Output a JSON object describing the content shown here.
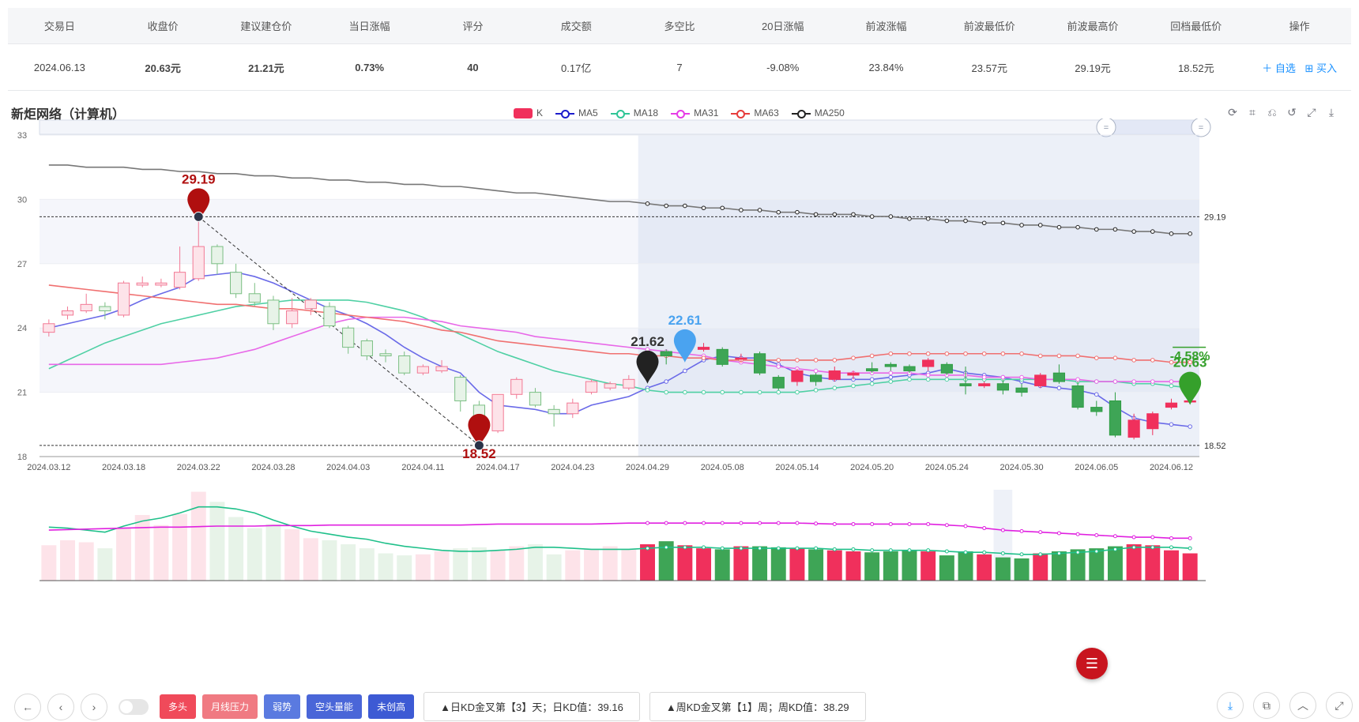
{
  "table": {
    "headers": [
      "交易日",
      "收盘价",
      "建议建仓价",
      "当日涨幅",
      "评分",
      "成交额",
      "多空比",
      "20日涨幅",
      "前波涨幅",
      "前波最低价",
      "前波最高价",
      "回档最低价",
      "操作"
    ],
    "row": {
      "date": "2024.06.13",
      "close": "20.63元",
      "suggest": "21.21元",
      "day_change": "0.73%",
      "score": "40",
      "amount": "0.17亿",
      "ratio": "7",
      "change20": "-9.08%",
      "wave_change": "23.84%",
      "wave_low": "23.57元",
      "wave_high": "29.19元",
      "pullback_low": "18.52元",
      "op_watch": "＋ 自选",
      "op_buy": "⊞ 买入"
    }
  },
  "chart_title": "新炬网络（计算机）",
  "legend": [
    {
      "label": "K",
      "color": "#f0305c",
      "icon": "rect"
    },
    {
      "label": "MA5",
      "color": "#1c1ccc",
      "icon": "line"
    },
    {
      "label": "MA18",
      "color": "#2fc596",
      "icon": "line"
    },
    {
      "label": "MA31",
      "color": "#e63ce6",
      "icon": "line"
    },
    {
      "label": "MA63",
      "color": "#e63c3c",
      "icon": "line"
    },
    {
      "label": "MA250",
      "color": "#222222",
      "icon": "line"
    }
  ],
  "toolbox": [
    "refresh-icon",
    "zoom-area-icon",
    "zoom-reset-icon",
    "restore-icon",
    "fullscreen-icon",
    "download-icon"
  ],
  "chart_data": {
    "type": "candlestick",
    "ylim": [
      18,
      33
    ],
    "yticks": [
      "33",
      "30",
      "27",
      "24",
      "21",
      "18"
    ],
    "xticks": [
      "2024.03.12",
      "2024.03.18",
      "2024.03.22",
      "2024.03.28",
      "2024.04.03",
      "2024.04.11",
      "2024.04.17",
      "2024.04.23",
      "2024.04.29",
      "2024.05.08",
      "2024.05.14",
      "2024.05.20",
      "2024.05.24",
      "2024.05.30",
      "2024.06.05",
      "2024.06.12"
    ],
    "hlines": [
      "29.19",
      "18.52"
    ],
    "markers": [
      {
        "label": "29.19",
        "value": 29.19,
        "color": "#b00f0f",
        "label_color": "#b00f0f"
      },
      {
        "label": "18.52",
        "value": 18.52,
        "color": "#b00f0f",
        "label_color": "#b00f0f"
      },
      {
        "label": "21.62",
        "value": 21.62,
        "color": "#222222",
        "label_color": "#333333"
      },
      {
        "label": "22.61",
        "value": 22.61,
        "color": "#4aa3f0",
        "label_color": "#4aa3f0"
      },
      {
        "label": "20.63",
        "value": 20.63,
        "color": "#35a02b",
        "label_color": "#35a02b"
      }
    ],
    "right_annotation": "-4.58%",
    "candles": [
      [
        23.8,
        24.2,
        24.4,
        23.6
      ],
      [
        24.6,
        24.8,
        25.0,
        24.4
      ],
      [
        24.8,
        25.1,
        25.6,
        24.7
      ],
      [
        25.0,
        24.8,
        25.2,
        24.4
      ],
      [
        24.6,
        26.1,
        26.2,
        24.5
      ],
      [
        26.0,
        26.1,
        26.4,
        25.9
      ],
      [
        26.0,
        26.1,
        26.3,
        25.9
      ],
      [
        25.9,
        26.6,
        27.8,
        25.8
      ],
      [
        26.3,
        27.8,
        29.19,
        26.2
      ],
      [
        27.8,
        27.0,
        27.9,
        26.5
      ],
      [
        26.6,
        25.6,
        27.0,
        25.4
      ],
      [
        25.6,
        25.2,
        26.1,
        25.0
      ],
      [
        25.3,
        24.2,
        25.5,
        23.9
      ],
      [
        24.2,
        24.8,
        25.4,
        24.0
      ],
      [
        24.9,
        25.3,
        25.4,
        24.6
      ],
      [
        25.0,
        24.1,
        25.2,
        24.0
      ],
      [
        24.0,
        23.1,
        24.1,
        22.8
      ],
      [
        23.4,
        22.7,
        23.5,
        22.5
      ],
      [
        22.8,
        22.7,
        23.0,
        22.4
      ],
      [
        22.7,
        21.9,
        22.9,
        21.8
      ],
      [
        21.9,
        22.2,
        22.3,
        21.8
      ],
      [
        22.0,
        22.2,
        22.5,
        21.9
      ],
      [
        21.7,
        20.6,
        21.8,
        20.1
      ],
      [
        20.4,
        19.6,
        20.6,
        18.52
      ],
      [
        19.2,
        20.9,
        20.9,
        19.1
      ],
      [
        20.9,
        21.6,
        21.7,
        20.7
      ],
      [
        21.0,
        20.4,
        21.2,
        20.3
      ],
      [
        20.2,
        20.0,
        20.4,
        19.4
      ],
      [
        20.0,
        20.5,
        20.7,
        19.8
      ],
      [
        21.0,
        21.5,
        21.6,
        20.9
      ],
      [
        21.2,
        21.4,
        21.5,
        21.1
      ],
      [
        21.2,
        21.6,
        21.8,
        21.1
      ],
      [
        22.1,
        22.7,
        22.9,
        22.0
      ],
      [
        22.9,
        22.7,
        23.0,
        22.3
      ],
      [
        22.9,
        23.1,
        23.2,
        22.8
      ],
      [
        23.0,
        23.1,
        23.3,
        22.9
      ],
      [
        23.0,
        22.3,
        23.1,
        22.2
      ],
      [
        22.6,
        22.6,
        22.8,
        22.4
      ],
      [
        22.8,
        21.9,
        22.9,
        21.8
      ],
      [
        21.7,
        21.2,
        21.8,
        21.1
      ],
      [
        21.5,
        22.0,
        22.1,
        21.3
      ],
      [
        21.8,
        21.5,
        21.9,
        21.3
      ],
      [
        21.6,
        22.0,
        22.2,
        21.5
      ],
      [
        21.8,
        21.9,
        22.0,
        21.6
      ],
      [
        22.1,
        22.0,
        22.4,
        21.9
      ],
      [
        22.3,
        22.2,
        22.4,
        22.0
      ],
      [
        22.2,
        22.0,
        22.3,
        21.9
      ],
      [
        22.2,
        22.5,
        22.6,
        22.0
      ],
      [
        22.3,
        21.9,
        22.4,
        21.8
      ],
      [
        21.4,
        21.3,
        22.2,
        20.9
      ],
      [
        21.3,
        21.4,
        21.5,
        21.2
      ],
      [
        21.4,
        21.1,
        21.6,
        20.9
      ],
      [
        21.2,
        21.0,
        21.4,
        20.8
      ],
      [
        21.3,
        21.8,
        21.9,
        21.2
      ],
      [
        21.9,
        21.5,
        22.3,
        21.4
      ],
      [
        21.3,
        20.3,
        21.5,
        20.2
      ],
      [
        20.3,
        20.1,
        20.6,
        19.9
      ],
      [
        20.6,
        19.0,
        21.0,
        18.9
      ],
      [
        18.9,
        19.7,
        20.0,
        18.8
      ],
      [
        19.3,
        20.0,
        20.1,
        19.0
      ],
      [
        20.3,
        20.5,
        20.7,
        20.2
      ],
      [
        20.6,
        20.6,
        20.7,
        20.5
      ]
    ],
    "ma": [
      {
        "name": "MA5",
        "color": "#6a6ae8",
        "values": [
          24.0,
          24.2,
          24.4,
          24.6,
          24.9,
          25.3,
          25.6,
          25.9,
          26.4,
          26.5,
          26.6,
          26.4,
          26.1,
          25.7,
          25.3,
          24.9,
          24.6,
          24.2,
          23.7,
          23.1,
          22.6,
          22.2,
          21.9,
          21.0,
          20.4,
          20.3,
          20.2,
          20.0,
          20.0,
          20.4,
          20.6,
          20.8,
          21.2,
          21.5,
          22.0,
          22.5,
          22.7,
          22.6,
          22.6,
          22.3,
          21.9,
          21.7,
          21.6,
          21.6,
          21.6,
          21.7,
          21.8,
          21.9,
          22.1,
          21.9,
          21.8,
          21.7,
          21.5,
          21.3,
          21.2,
          21.1,
          20.9,
          20.3,
          19.8,
          19.6,
          19.5,
          19.4
        ]
      },
      {
        "name": "MA18",
        "color": "#4fd0a4",
        "values": [
          22.1,
          22.5,
          22.9,
          23.3,
          23.6,
          23.9,
          24.2,
          24.4,
          24.6,
          24.8,
          25.0,
          25.1,
          25.2,
          25.3,
          25.3,
          25.3,
          25.3,
          25.2,
          25.0,
          24.8,
          24.5,
          24.1,
          23.7,
          23.3,
          22.9,
          22.6,
          22.3,
          22.0,
          21.8,
          21.6,
          21.4,
          21.3,
          21.1,
          21.0,
          21.0,
          21.0,
          21.0,
          21.0,
          21.0,
          21.0,
          21.0,
          21.1,
          21.2,
          21.3,
          21.4,
          21.5,
          21.6,
          21.6,
          21.6,
          21.6,
          21.6,
          21.6,
          21.6,
          21.6,
          21.6,
          21.5,
          21.5,
          21.5,
          21.4,
          21.4,
          21.3,
          21.2
        ]
      },
      {
        "name": "MA31",
        "color": "#e868e8",
        "values": [
          22.3,
          22.3,
          22.3,
          22.3,
          22.3,
          22.3,
          22.3,
          22.4,
          22.5,
          22.6,
          22.8,
          23.0,
          23.3,
          23.6,
          23.9,
          24.2,
          24.4,
          24.5,
          24.5,
          24.5,
          24.4,
          24.3,
          24.1,
          24.0,
          23.9,
          23.8,
          23.6,
          23.5,
          23.4,
          23.3,
          23.2,
          23.1,
          23.0,
          22.9,
          22.8,
          22.7,
          22.5,
          22.4,
          22.3,
          22.2,
          22.1,
          22.0,
          21.9,
          21.9,
          21.9,
          21.9,
          21.9,
          21.8,
          21.8,
          21.8,
          21.7,
          21.7,
          21.7,
          21.6,
          21.6,
          21.6,
          21.5,
          21.5,
          21.5,
          21.5,
          21.5,
          21.5
        ]
      },
      {
        "name": "MA63",
        "color": "#f07070",
        "values": [
          26.0,
          25.9,
          25.8,
          25.7,
          25.6,
          25.5,
          25.4,
          25.3,
          25.2,
          25.1,
          25.1,
          25.0,
          24.9,
          24.9,
          24.8,
          24.7,
          24.6,
          24.5,
          24.4,
          24.3,
          24.1,
          23.9,
          23.8,
          23.6,
          23.4,
          23.3,
          23.2,
          23.1,
          23.0,
          22.9,
          22.8,
          22.8,
          22.7,
          22.7,
          22.6,
          22.6,
          22.5,
          22.5,
          22.5,
          22.5,
          22.5,
          22.5,
          22.5,
          22.6,
          22.7,
          22.8,
          22.8,
          22.8,
          22.8,
          22.8,
          22.8,
          22.8,
          22.8,
          22.7,
          22.7,
          22.7,
          22.6,
          22.6,
          22.5,
          22.5,
          22.4,
          22.4
        ]
      },
      {
        "name": "MA250",
        "color": "#777777",
        "values": [
          31.6,
          31.6,
          31.5,
          31.5,
          31.5,
          31.4,
          31.4,
          31.3,
          31.3,
          31.2,
          31.2,
          31.1,
          31.1,
          31.0,
          31.0,
          30.9,
          30.9,
          30.8,
          30.8,
          30.7,
          30.7,
          30.6,
          30.6,
          30.5,
          30.4,
          30.3,
          30.3,
          30.2,
          30.1,
          30.0,
          29.9,
          29.9,
          29.8,
          29.7,
          29.7,
          29.6,
          29.6,
          29.5,
          29.5,
          29.4,
          29.4,
          29.3,
          29.3,
          29.3,
          29.2,
          29.2,
          29.1,
          29.1,
          29.0,
          29.0,
          28.9,
          28.9,
          28.8,
          28.8,
          28.7,
          28.7,
          28.6,
          28.6,
          28.5,
          28.5,
          28.4,
          28.4
        ]
      }
    ],
    "volume": [
      3.5,
      4.0,
      3.8,
      3.2,
      5.2,
      6.5,
      5.5,
      6.6,
      8.8,
      7.8,
      6.3,
      5.2,
      5.6,
      5.1,
      4.2,
      4.0,
      3.6,
      3.2,
      2.7,
      2.5,
      2.6,
      2.9,
      3.2,
      3.3,
      3.0,
      3.4,
      3.6,
      2.6,
      3.0,
      3.1,
      3.4,
      3.1,
      3.6,
      3.9,
      3.5,
      3.2,
      3.1,
      3.4,
      3.4,
      3.3,
      3.2,
      3.1,
      3.0,
      2.9,
      2.8,
      2.9,
      3.0,
      2.9,
      2.5,
      2.9,
      2.6,
      2.3,
      2.2,
      2.7,
      2.9,
      3.1,
      3.2,
      3.4,
      3.6,
      3.5,
      3.0,
      2.7
    ],
    "vol_ma1": [
      5.3,
      5.2,
      5.0,
      4.8,
      5.4,
      5.9,
      6.2,
      6.7,
      7.3,
      7.3,
      7.1,
      6.7,
      6.0,
      5.4,
      4.9,
      4.6,
      4.3,
      4.1,
      3.7,
      3.4,
      3.2,
      3.0,
      2.9,
      2.9,
      3.0,
      3.1,
      3.3,
      3.3,
      3.2,
      3.1,
      3.1,
      3.1,
      3.2,
      3.3,
      3.3,
      3.3,
      3.2,
      3.2,
      3.2,
      3.2,
      3.2,
      3.2,
      3.1,
      3.1,
      3.0,
      3.0,
      3.0,
      3.0,
      2.9,
      2.8,
      2.8,
      2.7,
      2.6,
      2.6,
      2.7,
      2.8,
      2.9,
      3.1,
      3.3,
      3.3,
      3.3,
      3.2
    ],
    "vol_ma2": [
      5.0,
      5.05,
      5.1,
      5.15,
      5.2,
      5.25,
      5.3,
      5.3,
      5.35,
      5.4,
      5.4,
      5.4,
      5.45,
      5.45,
      5.45,
      5.5,
      5.5,
      5.5,
      5.5,
      5.5,
      5.5,
      5.5,
      5.5,
      5.55,
      5.6,
      5.6,
      5.6,
      5.6,
      5.6,
      5.6,
      5.65,
      5.7,
      5.7,
      5.7,
      5.7,
      5.7,
      5.7,
      5.7,
      5.7,
      5.7,
      5.7,
      5.65,
      5.6,
      5.6,
      5.6,
      5.6,
      5.6,
      5.6,
      5.5,
      5.4,
      5.2,
      5.0,
      4.9,
      4.8,
      4.7,
      4.6,
      4.5,
      4.4,
      4.3,
      4.3,
      4.2,
      4.2
    ]
  },
  "bottom": {
    "tags": [
      {
        "label": "多头",
        "color": "#f04a5a"
      },
      {
        "label": "月线压力",
        "color": "#f07a82"
      },
      {
        "label": "弱势",
        "color": "#5a7ae0"
      },
      {
        "label": "空头量能",
        "color": "#4a66d8"
      },
      {
        "label": "未创高",
        "color": "#3d5ad4"
      }
    ],
    "info1": "▲日KD金叉第【3】天；日KD值：39.16",
    "info2": "▲周KD金叉第【1】周；周KD值：38.29"
  }
}
